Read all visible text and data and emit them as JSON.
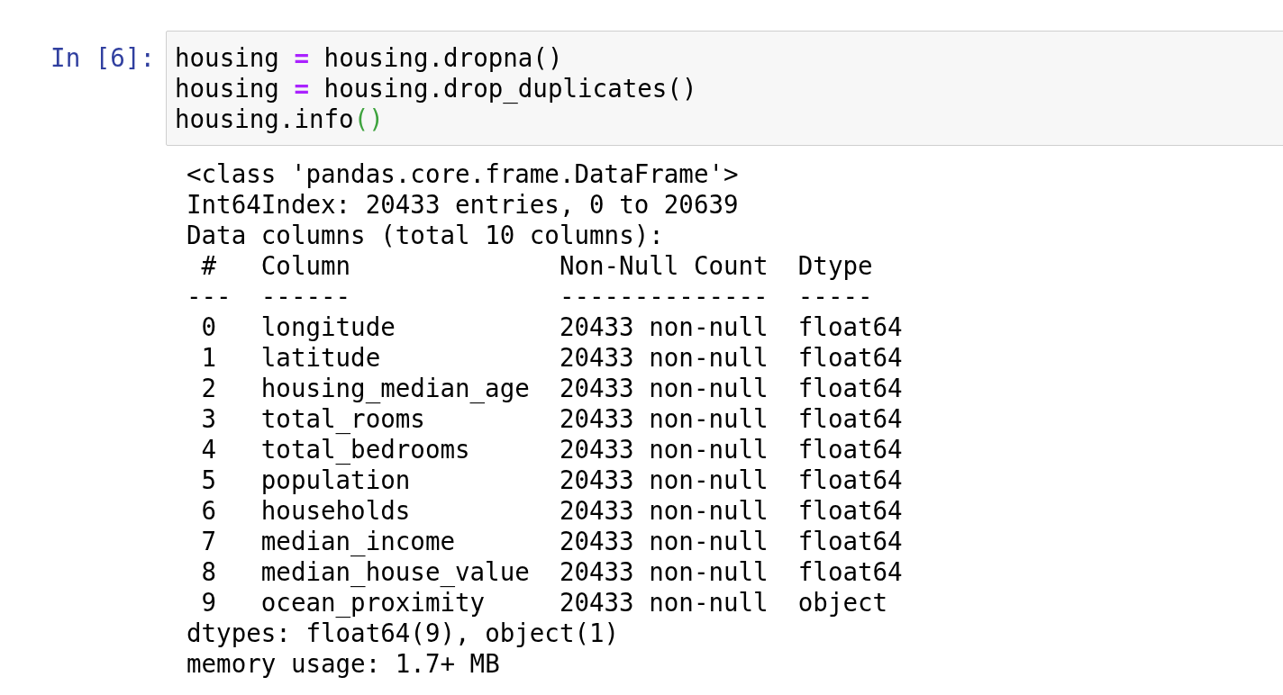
{
  "cell": {
    "prompt": "In [6]:",
    "code_lines": [
      [
        {
          "kind": "name",
          "text": "housing "
        },
        {
          "kind": "operator",
          "text": "="
        },
        {
          "kind": "plain",
          "text": " housing.dropna()"
        }
      ],
      [
        {
          "kind": "name",
          "text": "housing "
        },
        {
          "kind": "operator",
          "text": "="
        },
        {
          "kind": "plain",
          "text": " housing.drop_duplicates()"
        }
      ],
      [
        {
          "kind": "name",
          "text": "housing.info"
        },
        {
          "kind": "paren_match",
          "text": "()"
        }
      ]
    ],
    "output": {
      "header_lines": [
        "<class 'pandas.core.frame.DataFrame'>",
        "Int64Index: 20433 entries, 0 to 20639",
        "Data columns (total 10 columns):"
      ],
      "table": {
        "columns": [
          "#",
          "Column",
          "Non-Null Count",
          "Dtype"
        ],
        "rules": [
          "---",
          "------",
          "--------------",
          "-----"
        ],
        "rows": [
          [
            "0",
            "longitude",
            "20433 non-null",
            "float64"
          ],
          [
            "1",
            "latitude",
            "20433 non-null",
            "float64"
          ],
          [
            "2",
            "housing_median_age",
            "20433 non-null",
            "float64"
          ],
          [
            "3",
            "total_rooms",
            "20433 non-null",
            "float64"
          ],
          [
            "4",
            "total_bedrooms",
            "20433 non-null",
            "float64"
          ],
          [
            "5",
            "population",
            "20433 non-null",
            "float64"
          ],
          [
            "6",
            "households",
            "20433 non-null",
            "float64"
          ],
          [
            "7",
            "median_income",
            "20433 non-null",
            "float64"
          ],
          [
            "8",
            "median_house_value",
            "20433 non-null",
            "float64"
          ],
          [
            "9",
            "ocean_proximity",
            "20433 non-null",
            "object"
          ]
        ]
      },
      "footer_lines": [
        "dtypes: float64(9), object(1)",
        "memory usage: 1.7+ MB"
      ]
    }
  }
}
